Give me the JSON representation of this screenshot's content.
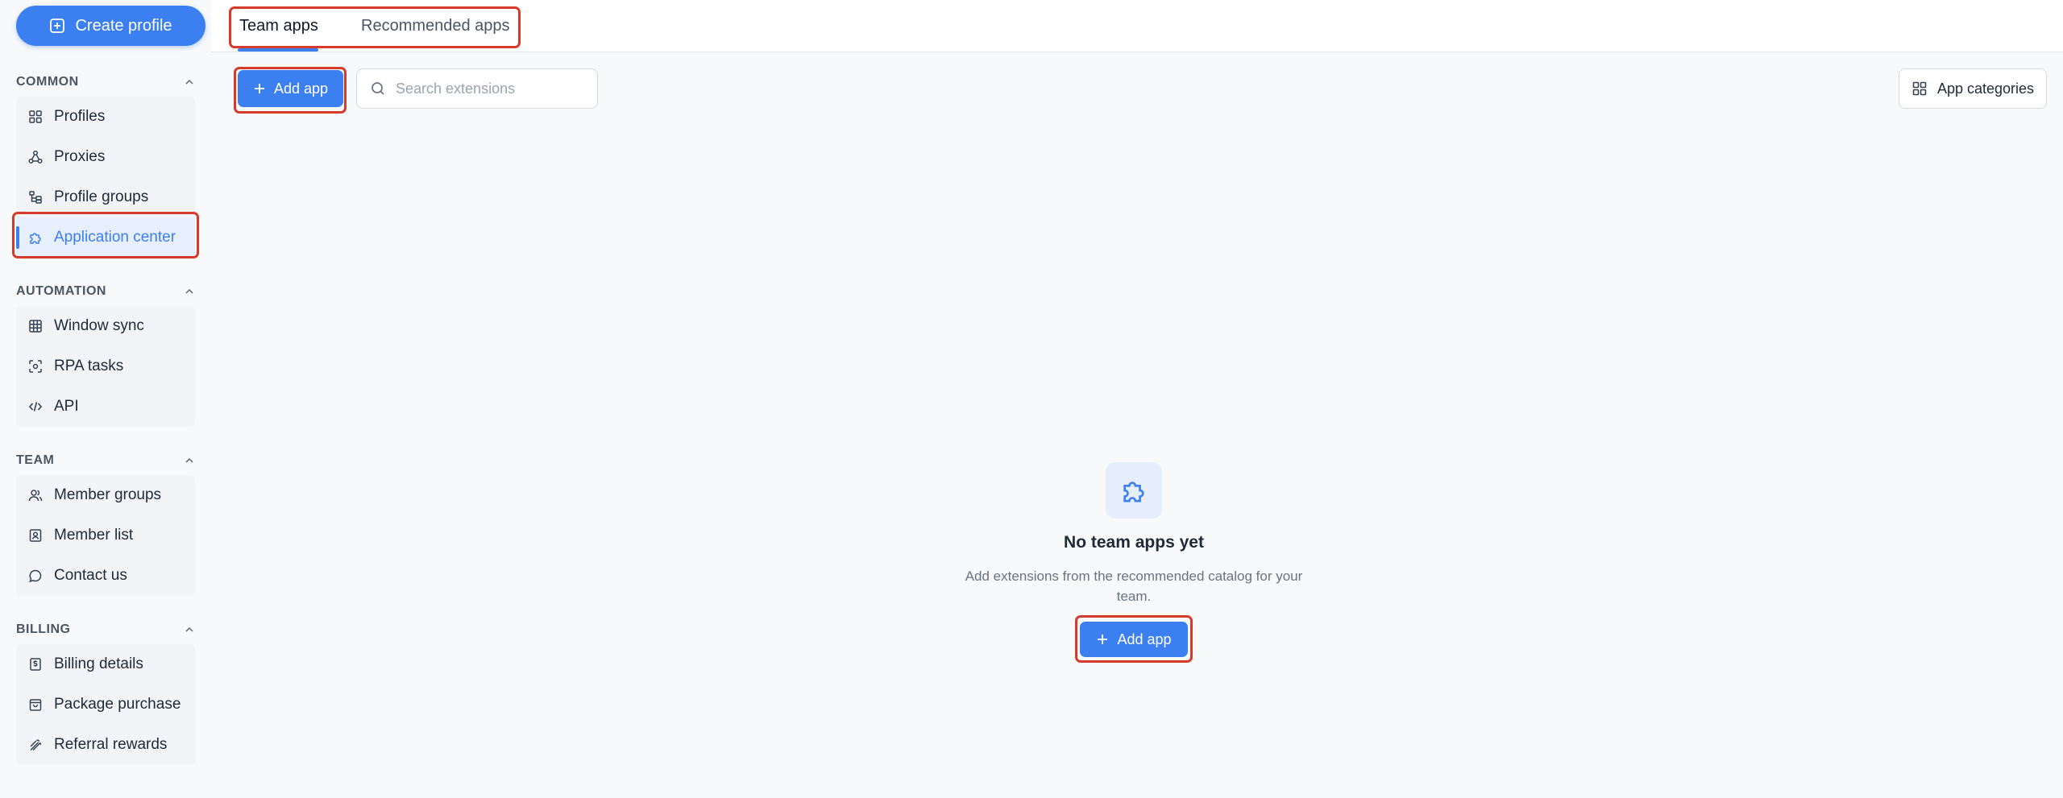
{
  "sidebar": {
    "create_button": "Create profile",
    "sections": {
      "common": {
        "title": "COMMON",
        "items": [
          {
            "label": "Profiles",
            "icon": "grid-icon"
          },
          {
            "label": "Proxies",
            "icon": "proxy-network-icon"
          },
          {
            "label": "Profile groups",
            "icon": "tree-icon"
          },
          {
            "label": "Application center",
            "icon": "puzzle-icon",
            "active": true
          }
        ]
      },
      "automation": {
        "title": "AUTOMATION",
        "items": [
          {
            "label": "Window sync",
            "icon": "table-icon"
          },
          {
            "label": "RPA tasks",
            "icon": "scan-icon"
          },
          {
            "label": "API",
            "icon": "code-icon"
          }
        ]
      },
      "team": {
        "title": "TEAM",
        "items": [
          {
            "label": "Member groups",
            "icon": "users-icon"
          },
          {
            "label": "Member list",
            "icon": "contact-card-icon"
          },
          {
            "label": "Contact us",
            "icon": "chat-icon"
          }
        ]
      },
      "billing": {
        "title": "BILLING",
        "items": [
          {
            "label": "Billing details",
            "icon": "receipt-icon"
          },
          {
            "label": "Package purchase",
            "icon": "shopping-bag-icon"
          },
          {
            "label": "Referral rewards",
            "icon": "gift-icon"
          }
        ]
      }
    }
  },
  "tabs": {
    "team_apps": "Team apps",
    "recommended_apps": "Recommended apps"
  },
  "toolbar": {
    "add_app": "Add app",
    "search_placeholder": "Search extensions",
    "app_categories": "App categories"
  },
  "empty_state": {
    "icon": "puzzle-icon",
    "title": "No team apps yet",
    "description": "Add extensions from the recommended catalog for your team.",
    "add_app": "Add app"
  },
  "colors": {
    "accent": "#3b7ff0",
    "highlight": "#d63a2a"
  }
}
